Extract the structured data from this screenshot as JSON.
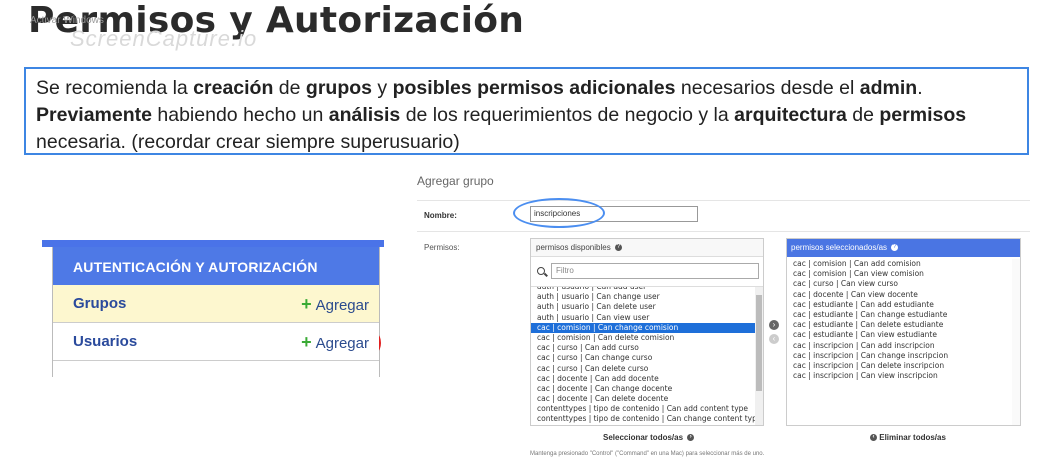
{
  "slide": {
    "title": "Permisos y Autorización",
    "watermark": "ScreenCapture.io",
    "watermark_small": "Activar Windows"
  },
  "info_box": {
    "segments": [
      {
        "t": "Se recomienda la ",
        "b": false
      },
      {
        "t": "creación",
        "b": true
      },
      {
        "t": " de ",
        "b": false
      },
      {
        "t": "grupos",
        "b": true
      },
      {
        "t": " y ",
        "b": false
      },
      {
        "t": "posibles permisos adicionales",
        "b": true
      },
      {
        "t": " necesarios desde el ",
        "b": false
      },
      {
        "t": "admin",
        "b": true
      },
      {
        "t": ". ",
        "b": false
      },
      {
        "t": "Previamente",
        "b": true
      },
      {
        "t": " habiendo hecho un ",
        "b": false
      },
      {
        "t": "análisis",
        "b": true
      },
      {
        "t": " de los requerimientos de negocio y la ",
        "b": false
      },
      {
        "t": "arquitectura",
        "b": true
      },
      {
        "t": " de ",
        "b": false
      },
      {
        "t": "permisos",
        "b": true
      },
      {
        "t": " necesaria. (recordar crear siempre superusuario)",
        "b": false
      }
    ]
  },
  "admin_panel": {
    "header": "AUTENTICACIÓN Y AUTORIZACIÓN",
    "rows": [
      {
        "label": "Grupos",
        "add": "Agregar"
      },
      {
        "label": "Usuarios",
        "add": "Agregar"
      }
    ]
  },
  "group_form": {
    "title": "Agregar grupo",
    "name_label": "Nombre:",
    "name_value": "inscripciones",
    "perms_label": "Permisos:",
    "available_header": "permisos disponibles",
    "filter_placeholder": "Filtro",
    "available": [
      "auth | usuario | Can add user",
      "auth | usuario | Can change user",
      "auth | usuario | Can delete user",
      "auth | usuario | Can view user",
      "cac | comision | Can change comision",
      "cac | comision | Can delete comision",
      "cac | curso | Can add curso",
      "cac | curso | Can change curso",
      "cac | curso | Can delete curso",
      "cac | docente | Can add docente",
      "cac | docente | Can change docente",
      "cac | docente | Can delete docente",
      "contenttypes | tipo de contenido | Can add content type",
      "contenttypes | tipo de contenido | Can change content type"
    ],
    "selected_available": "cac | comision | Can change comision",
    "chosen_header": "permisos seleccionados/as",
    "chosen": [
      "cac | comision | Can add comision",
      "cac | comision | Can view comision",
      "cac | curso | Can view curso",
      "cac | docente | Can view docente",
      "cac | estudiante | Can add estudiante",
      "cac | estudiante | Can change estudiante",
      "cac | estudiante | Can delete estudiante",
      "cac | estudiante | Can view estudiante",
      "cac | inscripcion | Can add inscripcion",
      "cac | inscripcion | Can change inscripcion",
      "cac | inscripcion | Can delete inscripcion",
      "cac | inscripcion | Can view inscripcion"
    ],
    "select_all": "Seleccionar todos/as",
    "remove_all": "Eliminar todos/as",
    "help": "Mantenga presionado \"Control\" (\"Command\" en una Mac) para seleccionar más de uno."
  },
  "colors": {
    "accent_blue": "#4e79e6",
    "highlight_red": "#e02020",
    "oval_blue": "#4b8ef0",
    "row_yellow": "#fdf7cf"
  }
}
